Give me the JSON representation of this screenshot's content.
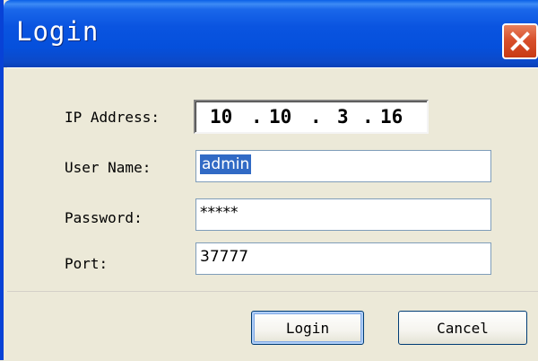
{
  "window": {
    "title": "Login",
    "colors": {
      "titlebar": "#0550dc",
      "close_button": "#d8502c",
      "client_bg": "#ece9d8",
      "selection": "#316ac5"
    }
  },
  "icons": {
    "close": "close-icon"
  },
  "form": {
    "ip_address": {
      "label": "IP Address:",
      "segments": [
        "10",
        "10",
        "3",
        "16"
      ],
      "separator": "."
    },
    "user_name": {
      "label": "User Name:",
      "value": "admin",
      "selected": true
    },
    "password": {
      "label": "Password:",
      "value": "*****"
    },
    "port": {
      "label": "Port:",
      "value": "37777"
    }
  },
  "buttons": {
    "login_label": "Login",
    "cancel_label": "Cancel"
  }
}
